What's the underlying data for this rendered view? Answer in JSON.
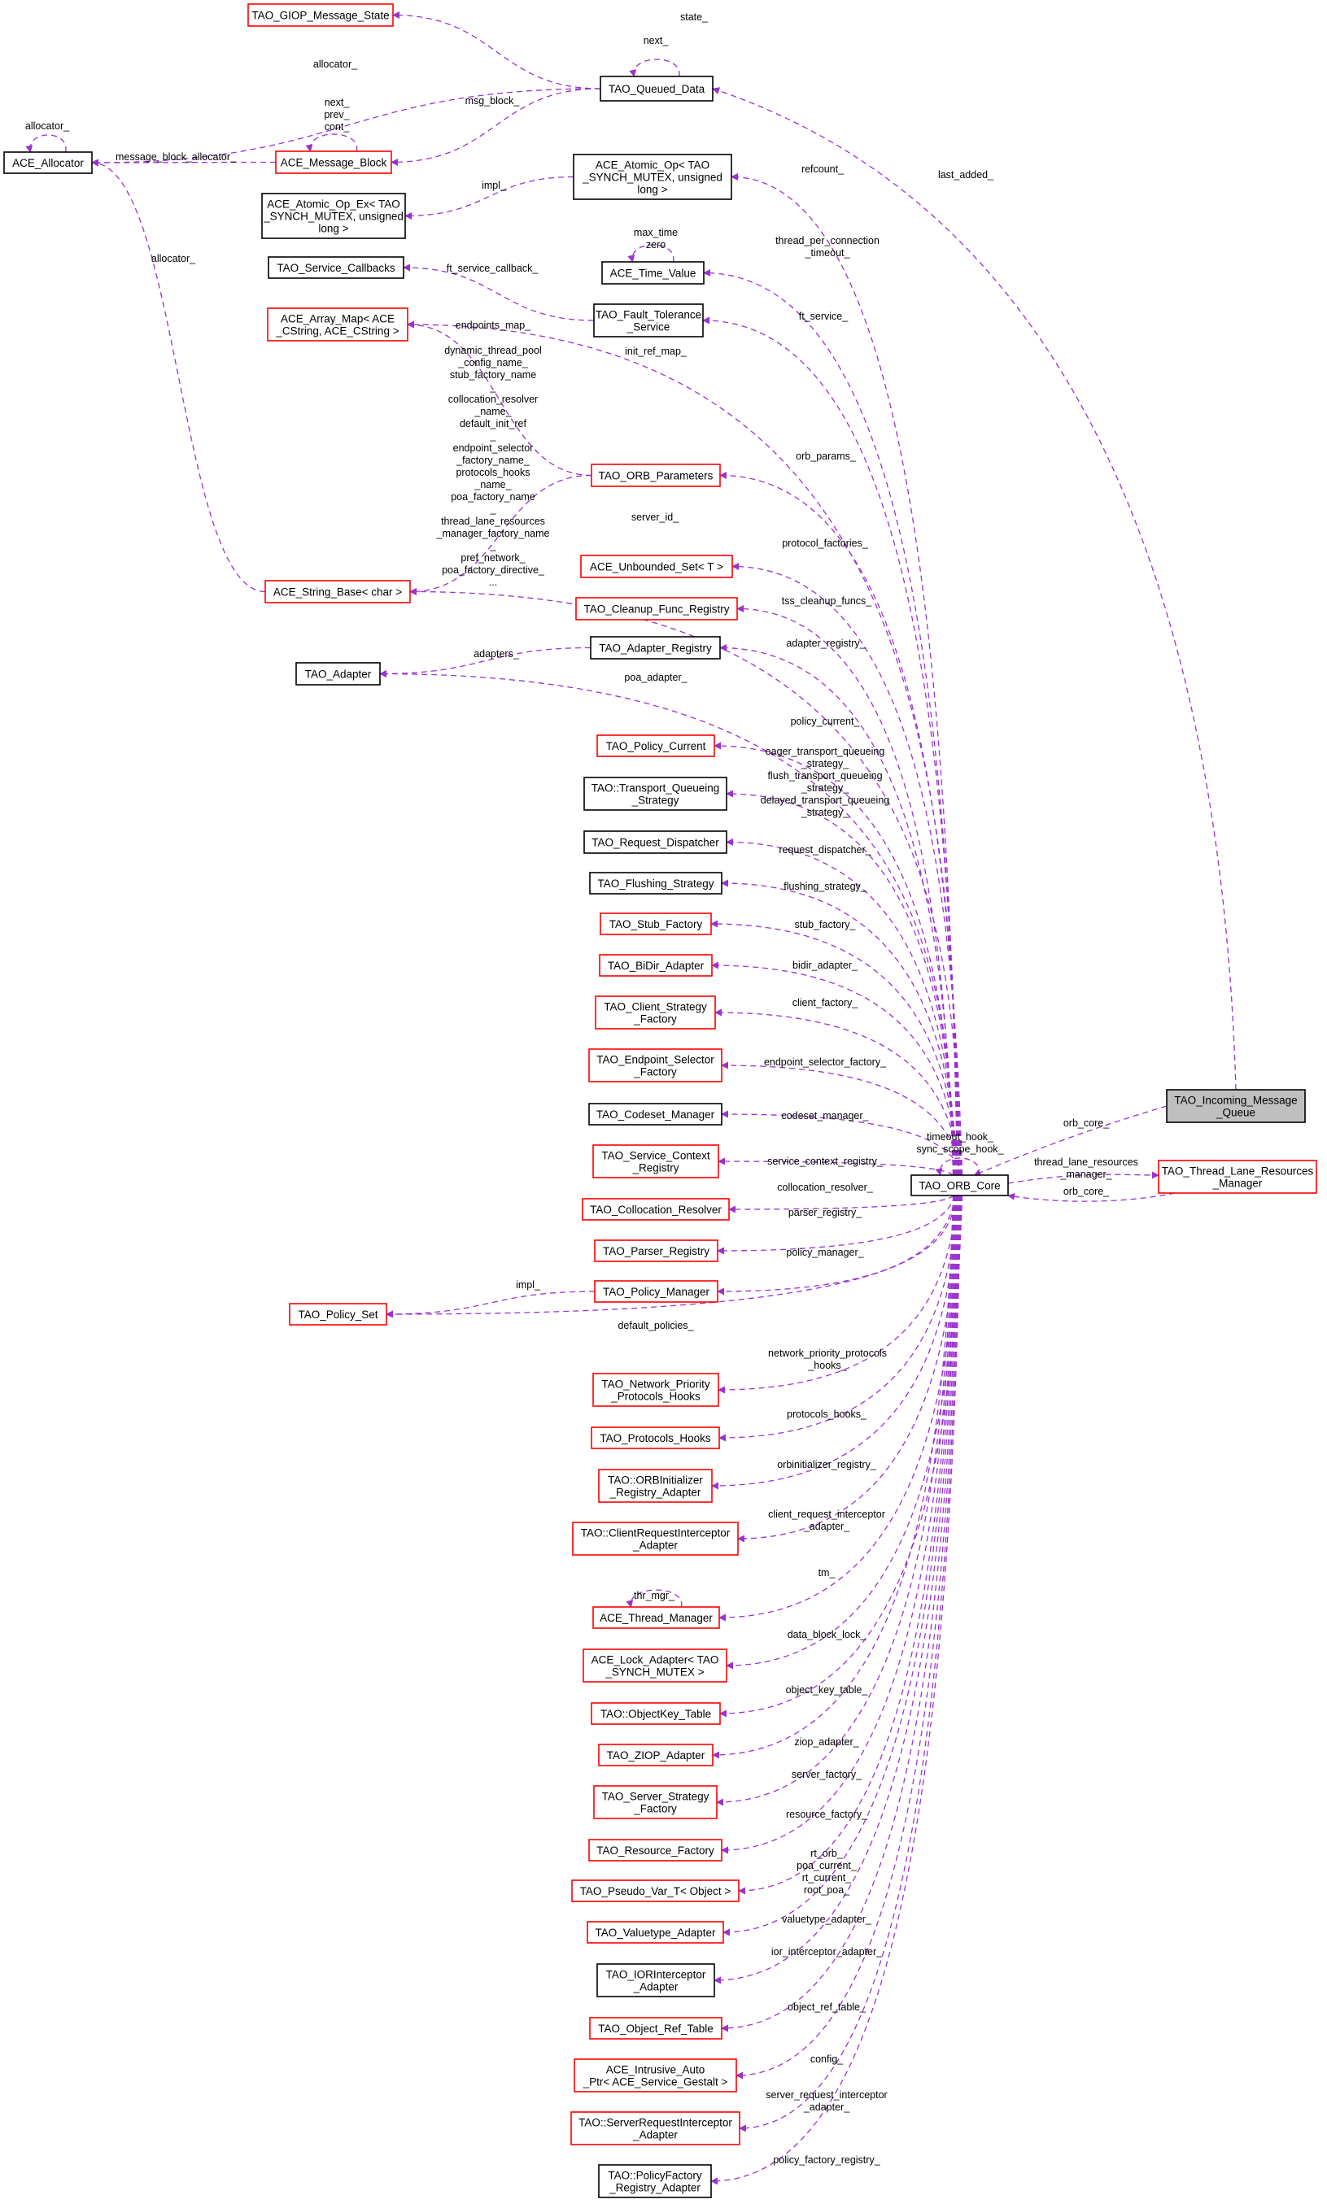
{
  "diagram": {
    "type": "collaboration-graph",
    "edge_color": "#9a32cd",
    "node_border_red": "#ff0000",
    "node_border_black": "#000000",
    "focus_node_fill": "#bfbfbf",
    "nodes": [
      {
        "id": "giop",
        "lines": [
          "TAO_GIOP_Message_State"
        ],
        "style": "red"
      },
      {
        "id": "queued",
        "lines": [
          "TAO_Queued_Data"
        ],
        "style": "black"
      },
      {
        "id": "alloc",
        "lines": [
          "ACE_Allocator"
        ],
        "style": "black"
      },
      {
        "id": "msgblock",
        "lines": [
          "ACE_Message_Block"
        ],
        "style": "red"
      },
      {
        "id": "atomic",
        "lines": [
          "ACE_Atomic_Op< TAO",
          "_SYNCH_MUTEX, unsigned",
          "long >"
        ],
        "style": "black"
      },
      {
        "id": "atomicex",
        "lines": [
          "ACE_Atomic_Op_Ex< TAO",
          "_SYNCH_MUTEX, unsigned",
          "long >"
        ],
        "style": "black"
      },
      {
        "id": "timevalue",
        "lines": [
          "ACE_Time_Value"
        ],
        "style": "black"
      },
      {
        "id": "svccb",
        "lines": [
          "TAO_Service_Callbacks"
        ],
        "style": "black"
      },
      {
        "id": "ft",
        "lines": [
          "TAO_Fault_Tolerance",
          "_Service"
        ],
        "style": "black"
      },
      {
        "id": "arraymap",
        "lines": [
          "ACE_Array_Map< ACE",
          "_CString, ACE_CString >"
        ],
        "style": "red"
      },
      {
        "id": "orbparams",
        "lines": [
          "TAO_ORB_Parameters"
        ],
        "style": "red"
      },
      {
        "id": "stringbase",
        "lines": [
          "ACE_String_Base< char >"
        ],
        "style": "red"
      },
      {
        "id": "unbounded",
        "lines": [
          "ACE_Unbounded_Set< T >"
        ],
        "style": "red"
      },
      {
        "id": "cleanup",
        "lines": [
          "TAO_Cleanup_Func_Registry"
        ],
        "style": "red"
      },
      {
        "id": "adapterreg",
        "lines": [
          "TAO_Adapter_Registry"
        ],
        "style": "black"
      },
      {
        "id": "adapter",
        "lines": [
          "TAO_Adapter"
        ],
        "style": "black"
      },
      {
        "id": "policycurrent",
        "lines": [
          "TAO_Policy_Current"
        ],
        "style": "red"
      },
      {
        "id": "tqs",
        "lines": [
          "TAO::Transport_Queueing",
          "_Strategy"
        ],
        "style": "black"
      },
      {
        "id": "reqdisp",
        "lines": [
          "TAO_Request_Dispatcher"
        ],
        "style": "black"
      },
      {
        "id": "flushing",
        "lines": [
          "TAO_Flushing_Strategy"
        ],
        "style": "black"
      },
      {
        "id": "stubfac",
        "lines": [
          "TAO_Stub_Factory"
        ],
        "style": "red"
      },
      {
        "id": "bidir",
        "lines": [
          "TAO_BiDir_Adapter"
        ],
        "style": "red"
      },
      {
        "id": "clientsf",
        "lines": [
          "TAO_Client_Strategy",
          "_Factory"
        ],
        "style": "red"
      },
      {
        "id": "endpointsf",
        "lines": [
          "TAO_Endpoint_Selector",
          "_Factory"
        ],
        "style": "red"
      },
      {
        "id": "codeset",
        "lines": [
          "TAO_Codeset_Manager"
        ],
        "style": "black"
      },
      {
        "id": "svcctx",
        "lines": [
          "TAO_Service_Context",
          "_Registry"
        ],
        "style": "red"
      },
      {
        "id": "colloc",
        "lines": [
          "TAO_Collocation_Resolver"
        ],
        "style": "red"
      },
      {
        "id": "parser",
        "lines": [
          "TAO_Parser_Registry"
        ],
        "style": "red"
      },
      {
        "id": "policymgr",
        "lines": [
          "TAO_Policy_Manager"
        ],
        "style": "red"
      },
      {
        "id": "policyset",
        "lines": [
          "TAO_Policy_Set"
        ],
        "style": "red"
      },
      {
        "id": "netprio",
        "lines": [
          "TAO_Network_Priority",
          "_Protocols_Hooks"
        ],
        "style": "red"
      },
      {
        "id": "protohooks",
        "lines": [
          "TAO_Protocols_Hooks"
        ],
        "style": "red"
      },
      {
        "id": "orbinit",
        "lines": [
          "TAO::ORBInitializer",
          "_Registry_Adapter"
        ],
        "style": "red"
      },
      {
        "id": "clientreq",
        "lines": [
          "TAO::ClientRequestInterceptor",
          "_Adapter"
        ],
        "style": "red"
      },
      {
        "id": "thrmgr",
        "lines": [
          "ACE_Thread_Manager"
        ],
        "style": "red"
      },
      {
        "id": "lockadapter",
        "lines": [
          "ACE_Lock_Adapter< TAO",
          "_SYNCH_MUTEX >"
        ],
        "style": "red"
      },
      {
        "id": "objkey",
        "lines": [
          "TAO::ObjectKey_Table"
        ],
        "style": "red"
      },
      {
        "id": "ziop",
        "lines": [
          "TAO_ZIOP_Adapter"
        ],
        "style": "red"
      },
      {
        "id": "serversf",
        "lines": [
          "TAO_Server_Strategy",
          "_Factory"
        ],
        "style": "red"
      },
      {
        "id": "resfac",
        "lines": [
          "TAO_Resource_Factory"
        ],
        "style": "red"
      },
      {
        "id": "pseudovar",
        "lines": [
          "TAO_Pseudo_Var_T< Object >"
        ],
        "style": "red"
      },
      {
        "id": "valuetype",
        "lines": [
          "TAO_Valuetype_Adapter"
        ],
        "style": "red"
      },
      {
        "id": "iorinter",
        "lines": [
          "TAO_IORInterceptor",
          "_Adapter"
        ],
        "style": "black"
      },
      {
        "id": "objref",
        "lines": [
          "TAO_Object_Ref_Table"
        ],
        "style": "red"
      },
      {
        "id": "intrusive",
        "lines": [
          "ACE_Intrusive_Auto",
          "_Ptr< ACE_Service_Gestalt >"
        ],
        "style": "red"
      },
      {
        "id": "serverreq",
        "lines": [
          "TAO::ServerRequestInterceptor",
          "_Adapter"
        ],
        "style": "red"
      },
      {
        "id": "policyfac",
        "lines": [
          "TAO::PolicyFactory",
          "_Registry_Adapter"
        ],
        "style": "black"
      },
      {
        "id": "orbcore",
        "lines": [
          "TAO_ORB_Core"
        ],
        "style": "black"
      },
      {
        "id": "incoming",
        "lines": [
          "TAO_Incoming_Message",
          "_Queue"
        ],
        "style": "focus"
      },
      {
        "id": "tlrm",
        "lines": [
          "TAO_Thread_Lane_Resources",
          "_Manager"
        ],
        "style": "red"
      }
    ],
    "edges": [
      {
        "id": "e-state",
        "from": "queued",
        "to": "giop",
        "label": [
          "state_"
        ]
      },
      {
        "id": "e-next",
        "from": "queued",
        "to": "queued",
        "label": [
          "next_"
        ]
      },
      {
        "id": "e-qalloc",
        "from": "queued",
        "to": "alloc",
        "label": [
          "allocator_"
        ]
      },
      {
        "id": "e-msgblock",
        "from": "queued",
        "to": "msgblock",
        "label": [
          "msg_block_"
        ]
      },
      {
        "id": "e-allocself",
        "from": "alloc",
        "to": "alloc",
        "label": [
          "allocator_"
        ]
      },
      {
        "id": "e-mballoc",
        "from": "msgblock",
        "to": "alloc",
        "label": [
          "message_block_allocator_"
        ]
      },
      {
        "id": "e-mbself",
        "from": "msgblock",
        "to": "msgblock",
        "label": [
          "next_",
          "prev_",
          "cont_"
        ]
      },
      {
        "id": "e-impl",
        "from": "atomic",
        "to": "atomicex",
        "label": [
          "impl_"
        ]
      },
      {
        "id": "e-sballoc",
        "from": "stringbase",
        "to": "alloc",
        "label": [
          "allocator_"
        ]
      },
      {
        "id": "e-tvself",
        "from": "timevalue",
        "to": "timevalue",
        "label": [
          "max_time",
          "zero"
        ]
      },
      {
        "id": "e-ftcb",
        "from": "ft",
        "to": "svccb",
        "label": [
          "ft_service_callback_"
        ]
      },
      {
        "id": "e-endpoints",
        "from": "orbparams",
        "to": "arraymap",
        "label": [
          "endpoints_map_"
        ]
      },
      {
        "id": "e-strings",
        "from": "orbparams",
        "to": "stringbase",
        "label": [
          "dynamic_thread_pool",
          "_config_name_",
          "stub_factory_name",
          "_",
          "collocation_resolver",
          "_name_",
          "default_init_ref",
          "_",
          "endpoint_selector",
          "_factory_name_",
          "protocols_hooks",
          "_name_",
          "poa_factory_name",
          "_",
          "thread_lane_resources",
          "_manager_factory_name",
          "_",
          "pref_network_",
          "poa_factory_directive_",
          "..."
        ]
      },
      {
        "id": "e-adapters",
        "from": "adapterreg",
        "to": "adapter",
        "label": [
          "adapters_"
        ]
      },
      {
        "id": "e-pmimpl",
        "from": "policymgr",
        "to": "policyset",
        "label": [
          "impl_"
        ]
      },
      {
        "id": "e-thrself",
        "from": "thrmgr",
        "to": "thrmgr",
        "label": [
          "thr_mgr_"
        ]
      },
      {
        "id": "e-lastadded",
        "from": "incoming",
        "to": "queued",
        "label": [
          "last_added_"
        ]
      },
      {
        "id": "e-refcount",
        "from": "orbcore",
        "to": "atomic",
        "label": [
          "refcount_"
        ]
      },
      {
        "id": "e-tpct",
        "from": "orbcore",
        "to": "timevalue",
        "label": [
          "thread_per_connection",
          "_timeout_"
        ]
      },
      {
        "id": "e-ftsvc",
        "from": "orbcore",
        "to": "ft",
        "label": [
          "ft_service_"
        ]
      },
      {
        "id": "e-initref",
        "from": "orbcore",
        "to": "arraymap",
        "label": [
          "init_ref_map_"
        ]
      },
      {
        "id": "e-orbparams",
        "from": "orbcore",
        "to": "orbparams",
        "label": [
          "orb_params_"
        ]
      },
      {
        "id": "e-serverid",
        "from": "orbcore",
        "to": "stringbase",
        "label": [
          "server_id_"
        ]
      },
      {
        "id": "e-protofac",
        "from": "orbcore",
        "to": "unbounded",
        "label": [
          "protocol_factories_"
        ]
      },
      {
        "id": "e-tss",
        "from": "orbcore",
        "to": "cleanup",
        "label": [
          "tss_cleanup_funcs_"
        ]
      },
      {
        "id": "e-adreg",
        "from": "orbcore",
        "to": "adapterreg",
        "label": [
          "adapter_registry_"
        ]
      },
      {
        "id": "e-poaad",
        "from": "orbcore",
        "to": "adapter",
        "label": [
          "poa_adapter_"
        ]
      },
      {
        "id": "e-polcur",
        "from": "orbcore",
        "to": "policycurrent",
        "label": [
          "policy_current_"
        ]
      },
      {
        "id": "e-tqs",
        "from": "orbcore",
        "to": "tqs",
        "label": [
          "eager_transport_queueing",
          "_strategy_",
          "flush_transport_queueing",
          "_strategy_",
          "delayed_transport_queueing",
          "_strategy_"
        ]
      },
      {
        "id": "e-reqdisp",
        "from": "orbcore",
        "to": "reqdisp",
        "label": [
          "request_dispatcher_"
        ]
      },
      {
        "id": "e-flush",
        "from": "orbcore",
        "to": "flushing",
        "label": [
          "flushing_strategy_"
        ]
      },
      {
        "id": "e-stub",
        "from": "orbcore",
        "to": "stubfac",
        "label": [
          "stub_factory_"
        ]
      },
      {
        "id": "e-bidir",
        "from": "orbcore",
        "to": "bidir",
        "label": [
          "bidir_adapter_"
        ]
      },
      {
        "id": "e-clientf",
        "from": "orbcore",
        "to": "clientsf",
        "label": [
          "client_factory_"
        ]
      },
      {
        "id": "e-endpf",
        "from": "orbcore",
        "to": "endpointsf",
        "label": [
          "endpoint_selector_factory_"
        ]
      },
      {
        "id": "e-codeset",
        "from": "orbcore",
        "to": "codeset",
        "label": [
          "codeset_manager_"
        ]
      },
      {
        "id": "e-svcctx",
        "from": "orbcore",
        "to": "svcctx",
        "label": [
          "service_context_registry_"
        ]
      },
      {
        "id": "e-colloc",
        "from": "orbcore",
        "to": "colloc",
        "label": [
          "collocation_resolver_"
        ]
      },
      {
        "id": "e-parser",
        "from": "orbcore",
        "to": "parser",
        "label": [
          "parser_registry_"
        ]
      },
      {
        "id": "e-polmgr",
        "from": "orbcore",
        "to": "policymgr",
        "label": [
          "policy_manager_"
        ]
      },
      {
        "id": "e-defpol",
        "from": "orbcore",
        "to": "policyset",
        "label": [
          "default_policies_"
        ]
      },
      {
        "id": "e-netprio",
        "from": "orbcore",
        "to": "netprio",
        "label": [
          "network_priority_protocols",
          "_hooks_"
        ]
      },
      {
        "id": "e-protohooks",
        "from": "orbcore",
        "to": "protohooks",
        "label": [
          "protocols_hooks_"
        ]
      },
      {
        "id": "e-orbinit",
        "from": "orbcore",
        "to": "orbinit",
        "label": [
          "orbinitializer_registry_"
        ]
      },
      {
        "id": "e-clientreq",
        "from": "orbcore",
        "to": "clientreq",
        "label": [
          "client_request_interceptor",
          "_adapter_"
        ]
      },
      {
        "id": "e-tm",
        "from": "orbcore",
        "to": "thrmgr",
        "label": [
          "tm_"
        ]
      },
      {
        "id": "e-dbl",
        "from": "orbcore",
        "to": "lockadapter",
        "label": [
          "data_block_lock_"
        ]
      },
      {
        "id": "e-objkey",
        "from": "orbcore",
        "to": "objkey",
        "label": [
          "object_key_table_"
        ]
      },
      {
        "id": "e-ziop",
        "from": "orbcore",
        "to": "ziop",
        "label": [
          "ziop_adapter_"
        ]
      },
      {
        "id": "e-serverf",
        "from": "orbcore",
        "to": "serversf",
        "label": [
          "server_factory_"
        ]
      },
      {
        "id": "e-resfac",
        "from": "orbcore",
        "to": "resfac",
        "label": [
          "resource_factory_"
        ]
      },
      {
        "id": "e-pseudo",
        "from": "orbcore",
        "to": "pseudovar",
        "label": [
          "rt_orb_",
          "poa_current_",
          "rt_current_",
          "root_poa_"
        ]
      },
      {
        "id": "e-valuetype",
        "from": "orbcore",
        "to": "valuetype",
        "label": [
          "valuetype_adapter_"
        ]
      },
      {
        "id": "e-ior",
        "from": "orbcore",
        "to": "iorinter",
        "label": [
          "ior_interceptor_adapter_"
        ]
      },
      {
        "id": "e-objref",
        "from": "orbcore",
        "to": "objref",
        "label": [
          "object_ref_table_"
        ]
      },
      {
        "id": "e-config",
        "from": "orbcore",
        "to": "intrusive",
        "label": [
          "config_"
        ]
      },
      {
        "id": "e-serverreq",
        "from": "orbcore",
        "to": "serverreq",
        "label": [
          "server_request_interceptor",
          "_adapter_"
        ]
      },
      {
        "id": "e-polfac",
        "from": "orbcore",
        "to": "policyfac",
        "label": [
          "policy_factory_registry_"
        ]
      },
      {
        "id": "e-hooks",
        "from": "orbcore",
        "to": "orbcore",
        "label": [
          "timeout_hook_",
          "sync_scope_hook_"
        ]
      },
      {
        "id": "e-incore",
        "from": "incoming",
        "to": "orbcore",
        "label": [
          "orb_core_"
        ]
      },
      {
        "id": "e-tlrm",
        "from": "orbcore",
        "to": "tlrm",
        "label": [
          "thread_lane_resources",
          "_manager_"
        ]
      },
      {
        "id": "e-tlrmcore",
        "from": "tlrm",
        "to": "orbcore",
        "label": [
          "orb_core_"
        ]
      }
    ]
  }
}
